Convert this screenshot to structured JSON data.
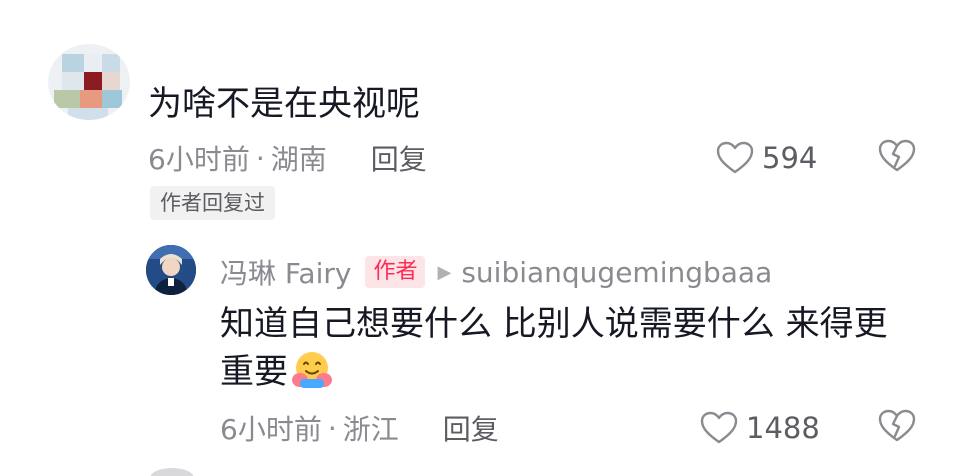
{
  "comment": {
    "text": "为啥不是在央视呢",
    "time": "6小时前",
    "separator": "·",
    "location": "湖南",
    "reply_label": "回复",
    "like_count": "594",
    "author_replied_badge": "作者回复过"
  },
  "reply": {
    "username": "冯琳 Fairy",
    "author_tag": "作者",
    "reply_to": "suibianqugemingbaaa",
    "text": "知道自己想要什么 比别人说需要什么 来得更重要",
    "emoji": "hugging-face",
    "time": "6小时前",
    "separator": "·",
    "location": "浙江",
    "reply_label": "回复",
    "like_count": "1488"
  },
  "colors": {
    "text_primary": "#161823",
    "text_secondary": "#8a8b91",
    "author_tag_bg": "#fde4e6",
    "author_tag_text": "#fe2c55"
  }
}
